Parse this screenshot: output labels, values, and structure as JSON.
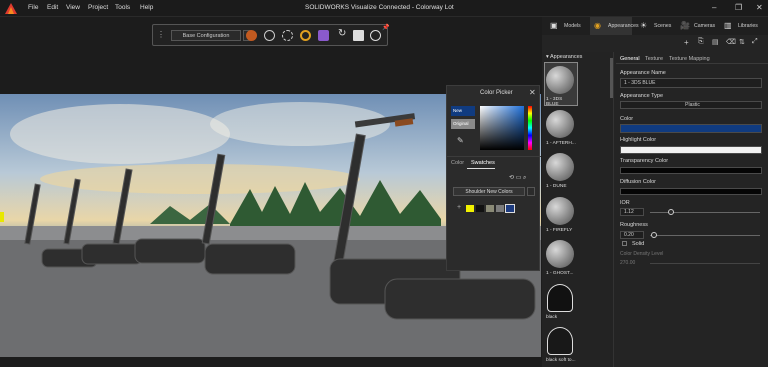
{
  "titlebar": {
    "title": "SOLIDWORKS Visualize Connected - Colorway Lot",
    "menu": [
      "File",
      "Edit",
      "View",
      "Project",
      "Tools",
      "Help"
    ]
  },
  "toolbar": {
    "configuration": "Base Configuration"
  },
  "color_picker": {
    "title": "Color Picker",
    "new_label": "New",
    "original_label": "Original",
    "tabs": [
      "Color",
      "Swatches"
    ],
    "swatch_set": "Shoulder New Colors",
    "swatch_colors": [
      "#f2f200",
      "#111111",
      "#8a8a76",
      "#7c7c7c",
      "#1e3c80"
    ]
  },
  "right_panel": {
    "top_tabs": [
      "Models",
      "Appearances",
      "Scenes",
      "Cameras",
      "Libraries"
    ],
    "list_header": "Appearances",
    "appearance_items": [
      "1 - 3DS BLUE",
      "1 - AFTERH...",
      "1 - DUNE",
      "1 - FIREFLY",
      "1 - GHOST...",
      "black",
      "black soft to..."
    ],
    "sub_tabs": [
      "General",
      "Texture",
      "Texture Mapping"
    ],
    "appearance_name_label": "Appearance Name",
    "appearance_name_value": "1 - 3DS BLUE",
    "appearance_type_label": "Appearance Type",
    "appearance_type_value": "Plastic",
    "color_label": "Color",
    "color_value": "#103b80",
    "highlight_color_label": "Highlight Color",
    "transparency_color_label": "Transparency Color",
    "diffusion_color_label": "Diffusion Color",
    "ior_label": "IOR",
    "ior_value": "1.12",
    "roughness_label": "Roughness",
    "roughness_value": "0.20",
    "solid_label": "Solid",
    "density_label": "Color Density Level",
    "density_value": "270.00"
  }
}
